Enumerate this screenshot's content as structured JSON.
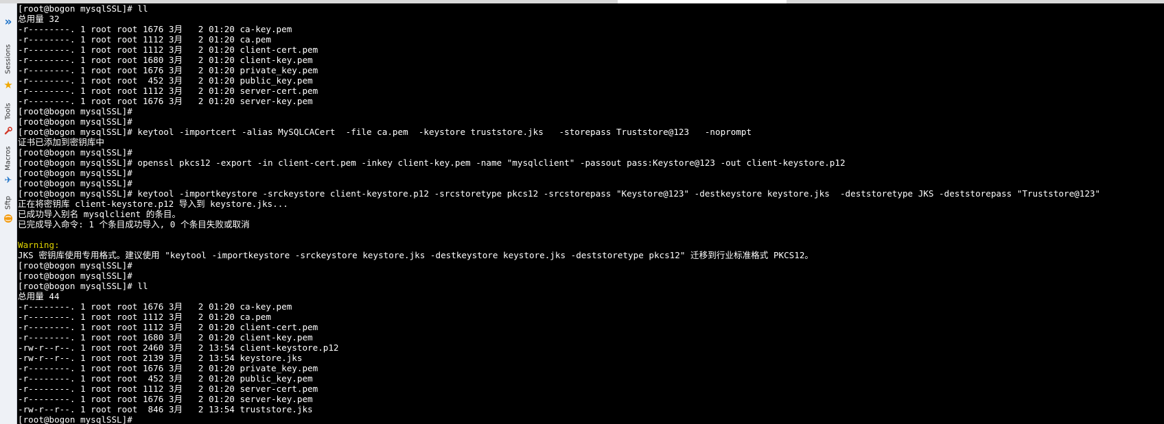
{
  "sidebar": {
    "expand_icon": "»",
    "sessions_label": "Sessions",
    "tools_label": "Tools",
    "macros_label": "Macros",
    "sftp_label": "Sftp",
    "star_icon": "★",
    "plane_icon": "✈"
  },
  "terminal": {
    "lines": [
      "[root@bogon mysqlSSL]# ll",
      "总用量 32",
      "-r--------. 1 root root 1676 3月   2 01:20 ca-key.pem",
      "-r--------. 1 root root 1112 3月   2 01:20 ca.pem",
      "-r--------. 1 root root 1112 3月   2 01:20 client-cert.pem",
      "-r--------. 1 root root 1680 3月   2 01:20 client-key.pem",
      "-r--------. 1 root root 1676 3月   2 01:20 private_key.pem",
      "-r--------. 1 root root  452 3月   2 01:20 public_key.pem",
      "-r--------. 1 root root 1112 3月   2 01:20 server-cert.pem",
      "-r--------. 1 root root 1676 3月   2 01:20 server-key.pem",
      "[root@bogon mysqlSSL]#",
      "[root@bogon mysqlSSL]#",
      "[root@bogon mysqlSSL]# keytool -importcert -alias MySQLCACert  -file ca.pem  -keystore truststore.jks   -storepass Truststore@123   -noprompt",
      "证书已添加到密钥库中",
      "[root@bogon mysqlSSL]#",
      "[root@bogon mysqlSSL]# openssl pkcs12 -export -in client-cert.pem -inkey client-key.pem -name \"mysqlclient\" -passout pass:Keystore@123 -out client-keystore.p12",
      "[root@bogon mysqlSSL]#",
      "[root@bogon mysqlSSL]#",
      "[root@bogon mysqlSSL]# keytool -importkeystore -srckeystore client-keystore.p12 -srcstoretype pkcs12 -srcstorepass \"Keystore@123\" -destkeystore keystore.jks  -deststoretype JKS -deststorepass \"Truststore@123\"",
      "正在将密钥库 client-keystore.p12 导入到 keystore.jks...",
      "已成功导入别名 mysqlclient 的条目。",
      "已完成导入命令: 1 个条目成功导入, 0 个条目失败或取消",
      "",
      "Warning:",
      "JKS 密钥库使用专用格式。建议使用 \"keytool -importkeystore -srckeystore keystore.jks -destkeystore keystore.jks -deststoretype pkcs12\" 迁移到行业标准格式 PKCS12。",
      "[root@bogon mysqlSSL]#",
      "[root@bogon mysqlSSL]#",
      "[root@bogon mysqlSSL]# ll",
      "总用量 44",
      "-r--------. 1 root root 1676 3月   2 01:20 ca-key.pem",
      "-r--------. 1 root root 1112 3月   2 01:20 ca.pem",
      "-r--------. 1 root root 1112 3月   2 01:20 client-cert.pem",
      "-r--------. 1 root root 1680 3月   2 01:20 client-key.pem",
      "-rw-r--r--. 1 root root 2460 3月   2 13:54 client-keystore.p12",
      "-rw-r--r--. 1 root root 2139 3月   2 13:54 keystore.jks",
      "-r--------. 1 root root 1676 3月   2 01:20 private_key.pem",
      "-r--------. 1 root root  452 3月   2 01:20 public_key.pem",
      "-r--------. 1 root root 1112 3月   2 01:20 server-cert.pem",
      "-r--------. 1 root root 1676 3月   2 01:20 server-key.pem",
      "-rw-r--r--. 1 root root  846 3月   2 13:54 truststore.jks",
      "[root@bogon mysqlSSL]#"
    ],
    "warning_line_index": 23,
    "colors": {
      "background": "#000000",
      "text": "#ffffff",
      "warning": "#e0d300"
    }
  }
}
